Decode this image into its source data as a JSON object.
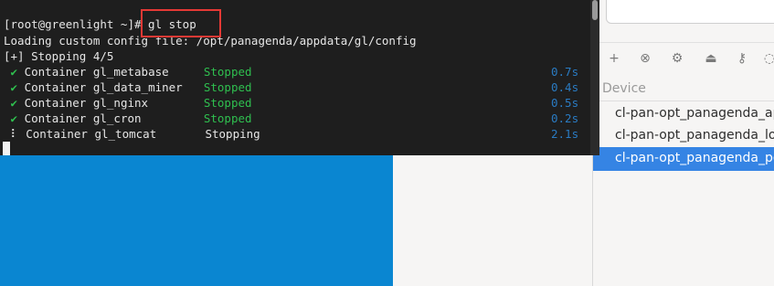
{
  "terminal": {
    "prompt": "[root@greenlight ~]# ",
    "command": "gl stop",
    "lines": {
      "loading": "Loading custom config file: /opt/panagenda/appdata/gl/config",
      "progress": "[+] Stopping 4/5"
    },
    "containers": [
      {
        "prefix": "Container",
        "name": "gl_metabase",
        "status": "Stopped",
        "time": "0.7s",
        "icon": "check-icon"
      },
      {
        "prefix": "Container",
        "name": "gl_data_miner",
        "status": "Stopped",
        "time": "0.4s",
        "icon": "check-icon"
      },
      {
        "prefix": "Container",
        "name": "gl_nginx",
        "status": "Stopped",
        "time": "0.5s",
        "icon": "check-icon"
      },
      {
        "prefix": "Container",
        "name": "gl_cron",
        "status": "Stopped",
        "time": "0.2s",
        "icon": "check-icon"
      },
      {
        "prefix": "Container",
        "name": "gl_tomcat",
        "status": "Stopping",
        "time": "2.1s",
        "icon": "spinner-icon"
      }
    ],
    "check_glyph": "✔",
    "spinner_glyph": "⠇"
  },
  "right_panel": {
    "toolbar_icons": [
      "add-icon",
      "remove-icon",
      "settings-icon",
      "eject-icon",
      "key-icon",
      "bulb-icon"
    ],
    "column_header": "Device",
    "devices": [
      {
        "label": "cl-pan-opt_panagenda_app",
        "selected": false
      },
      {
        "label": "cl-pan-opt_panagenda_log",
        "selected": false
      },
      {
        "label": "cl-pan-opt_panagenda_pgd",
        "selected": true
      }
    ]
  },
  "colors": {
    "terminal_bg": "#1e1e1e",
    "status_green": "#2fbf4f",
    "time_blue": "#2a7bc2",
    "highlight_red": "#e53935",
    "desktop_blue": "#0a86d1",
    "selection_blue": "#3584e4"
  }
}
